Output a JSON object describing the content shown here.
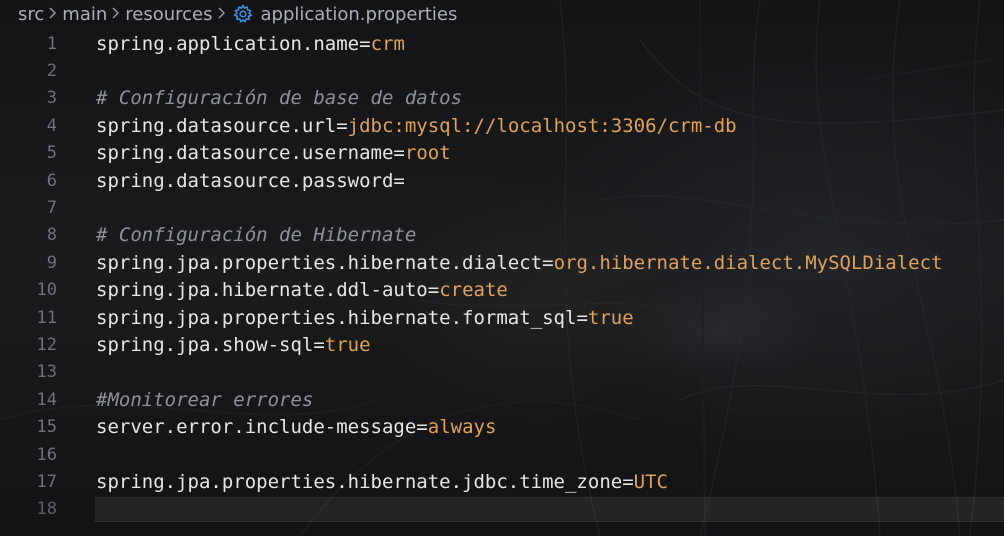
{
  "breadcrumb": {
    "segments": [
      "src",
      "main",
      "resources"
    ],
    "file": "application.properties",
    "file_icon": "gear-icon",
    "separator_icon": "chevron-right-icon"
  },
  "colors": {
    "key": "#e6e6e6",
    "value": "#e0a15c",
    "comment": "#8d939a",
    "line_number": "#6e7378"
  },
  "editor": {
    "current_line": 18,
    "lines": [
      {
        "n": "1",
        "key": "spring.application.name",
        "eq": "=",
        "value": "crm"
      },
      {
        "n": "2"
      },
      {
        "n": "3",
        "comment": "# Configuración de base de datos"
      },
      {
        "n": "4",
        "key": "spring.datasource.url",
        "eq": "=",
        "value": "jdbc:mysql://localhost:3306/crm-db"
      },
      {
        "n": "5",
        "key": "spring.datasource.username",
        "eq": "=",
        "value": "root"
      },
      {
        "n": "6",
        "key": "spring.datasource.password",
        "eq": "=",
        "value": ""
      },
      {
        "n": "7"
      },
      {
        "n": "8",
        "comment": "# Configuración de Hibernate"
      },
      {
        "n": "9",
        "key": "spring.jpa.properties.hibernate.dialect",
        "eq": "=",
        "value": "org.hibernate.dialect.MySQLDialect"
      },
      {
        "n": "10",
        "key": "spring.jpa.hibernate.ddl-auto",
        "eq": "=",
        "value": "create"
      },
      {
        "n": "11",
        "key": "spring.jpa.properties.hibernate.format_sql",
        "eq": "=",
        "value": "true"
      },
      {
        "n": "12",
        "key": "spring.jpa.show-sql",
        "eq": "=",
        "value": "true"
      },
      {
        "n": "13"
      },
      {
        "n": "14",
        "comment": "#Monitorear errores"
      },
      {
        "n": "15",
        "key": "server.error.include-message",
        "eq": "=",
        "value": "always"
      },
      {
        "n": "16"
      },
      {
        "n": "17",
        "key": "spring.jpa.properties.hibernate.jdbc.time_zone",
        "eq": "=",
        "value": "UTC"
      },
      {
        "n": "18"
      }
    ]
  }
}
